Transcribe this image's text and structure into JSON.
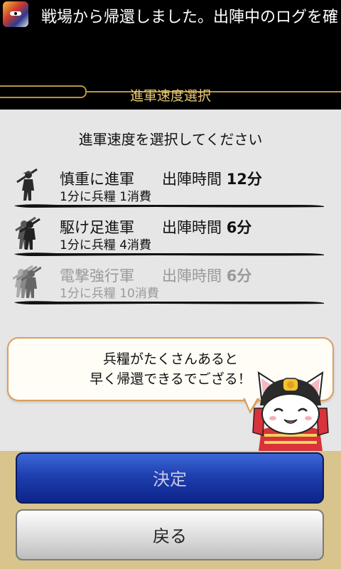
{
  "notification": {
    "ticker_text": "戦場から帰還しました。出陣中のログを確"
  },
  "dialog": {
    "title": "進軍速度選択",
    "prompt": "進軍速度を選択してください"
  },
  "options": [
    {
      "name": "慎重に進軍",
      "time_label": "出陣時間",
      "time_value": "12分",
      "cost": "1分に兵糧 1消費",
      "enabled": true
    },
    {
      "name": "駆け足進軍",
      "time_label": "出陣時間",
      "time_value": "6分",
      "cost": "1分に兵糧 4消費",
      "enabled": true
    },
    {
      "name": "電撃強行軍",
      "time_label": "出陣時間",
      "time_value": "6分",
      "cost": "1分に兵糧 10消費",
      "enabled": false
    }
  ],
  "speech_bubble": {
    "line1": "兵糧がたくさんあると",
    "line2": "早く帰還できるでござる！"
  },
  "buttons": {
    "confirm_label": "決定",
    "back_label": "戻る"
  },
  "colors": {
    "title_gold": "#e6c873",
    "frame_gold": "#b9953f",
    "confirm_blue": "#1e3fae",
    "bottom_panel": "#d8c48c",
    "content_bg": "#e6e6e6"
  }
}
